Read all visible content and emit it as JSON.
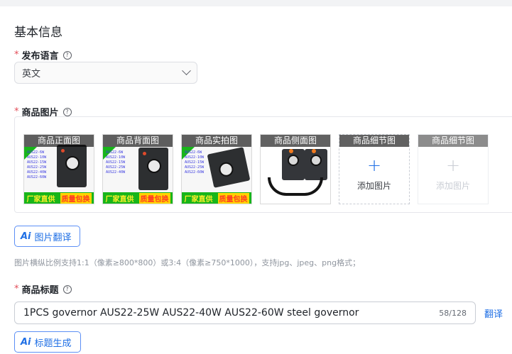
{
  "section": {
    "title": "基本信息"
  },
  "language": {
    "label": "发布语言",
    "required_mark": "*",
    "help_icon": "question-circle-icon",
    "selected": "英文"
  },
  "images": {
    "label": "商品图片",
    "required_mark": "*",
    "help_icon": "question-circle-icon",
    "slots": [
      {
        "caption": "商品正面图",
        "filled": true,
        "banner_left": "厂家直供",
        "banner_right": "质量包换"
      },
      {
        "caption": "商品背面图",
        "filled": true,
        "banner_left": "厂家直供",
        "banner_right": "质量包换"
      },
      {
        "caption": "商品实拍图",
        "filled": true,
        "banner_left": "厂家直供",
        "banner_right": "质量包换"
      },
      {
        "caption": "商品侧面图",
        "filled": true
      },
      {
        "caption": "商品细节图",
        "filled": false,
        "add_label": "添加图片",
        "plus": "+"
      },
      {
        "caption": "商品细节图",
        "filled": false,
        "add_label": "添加图片",
        "plus": "+",
        "disabled": true
      }
    ],
    "translate_button": {
      "ai_mark": "Ai",
      "label": "图片翻译"
    },
    "hint": "图片横纵比例支持1:1（像素≥800*800）或3:4（像素≥750*1000），支持jpg、jpeg、png格式；"
  },
  "product_title": {
    "label": "商品标题",
    "required_mark": "*",
    "help_icon": "question-circle-icon",
    "value": "1PCS governor AUS22-25W AUS22-40W AUS22-60W steel governor",
    "counter": "58/128",
    "translate_link": "翻译",
    "generate_button": {
      "ai_mark": "Ai",
      "label": "标题生成"
    }
  },
  "colors": {
    "accent": "#1f6fe5",
    "required": "#e34d59",
    "banner_green": "#18b51a"
  }
}
